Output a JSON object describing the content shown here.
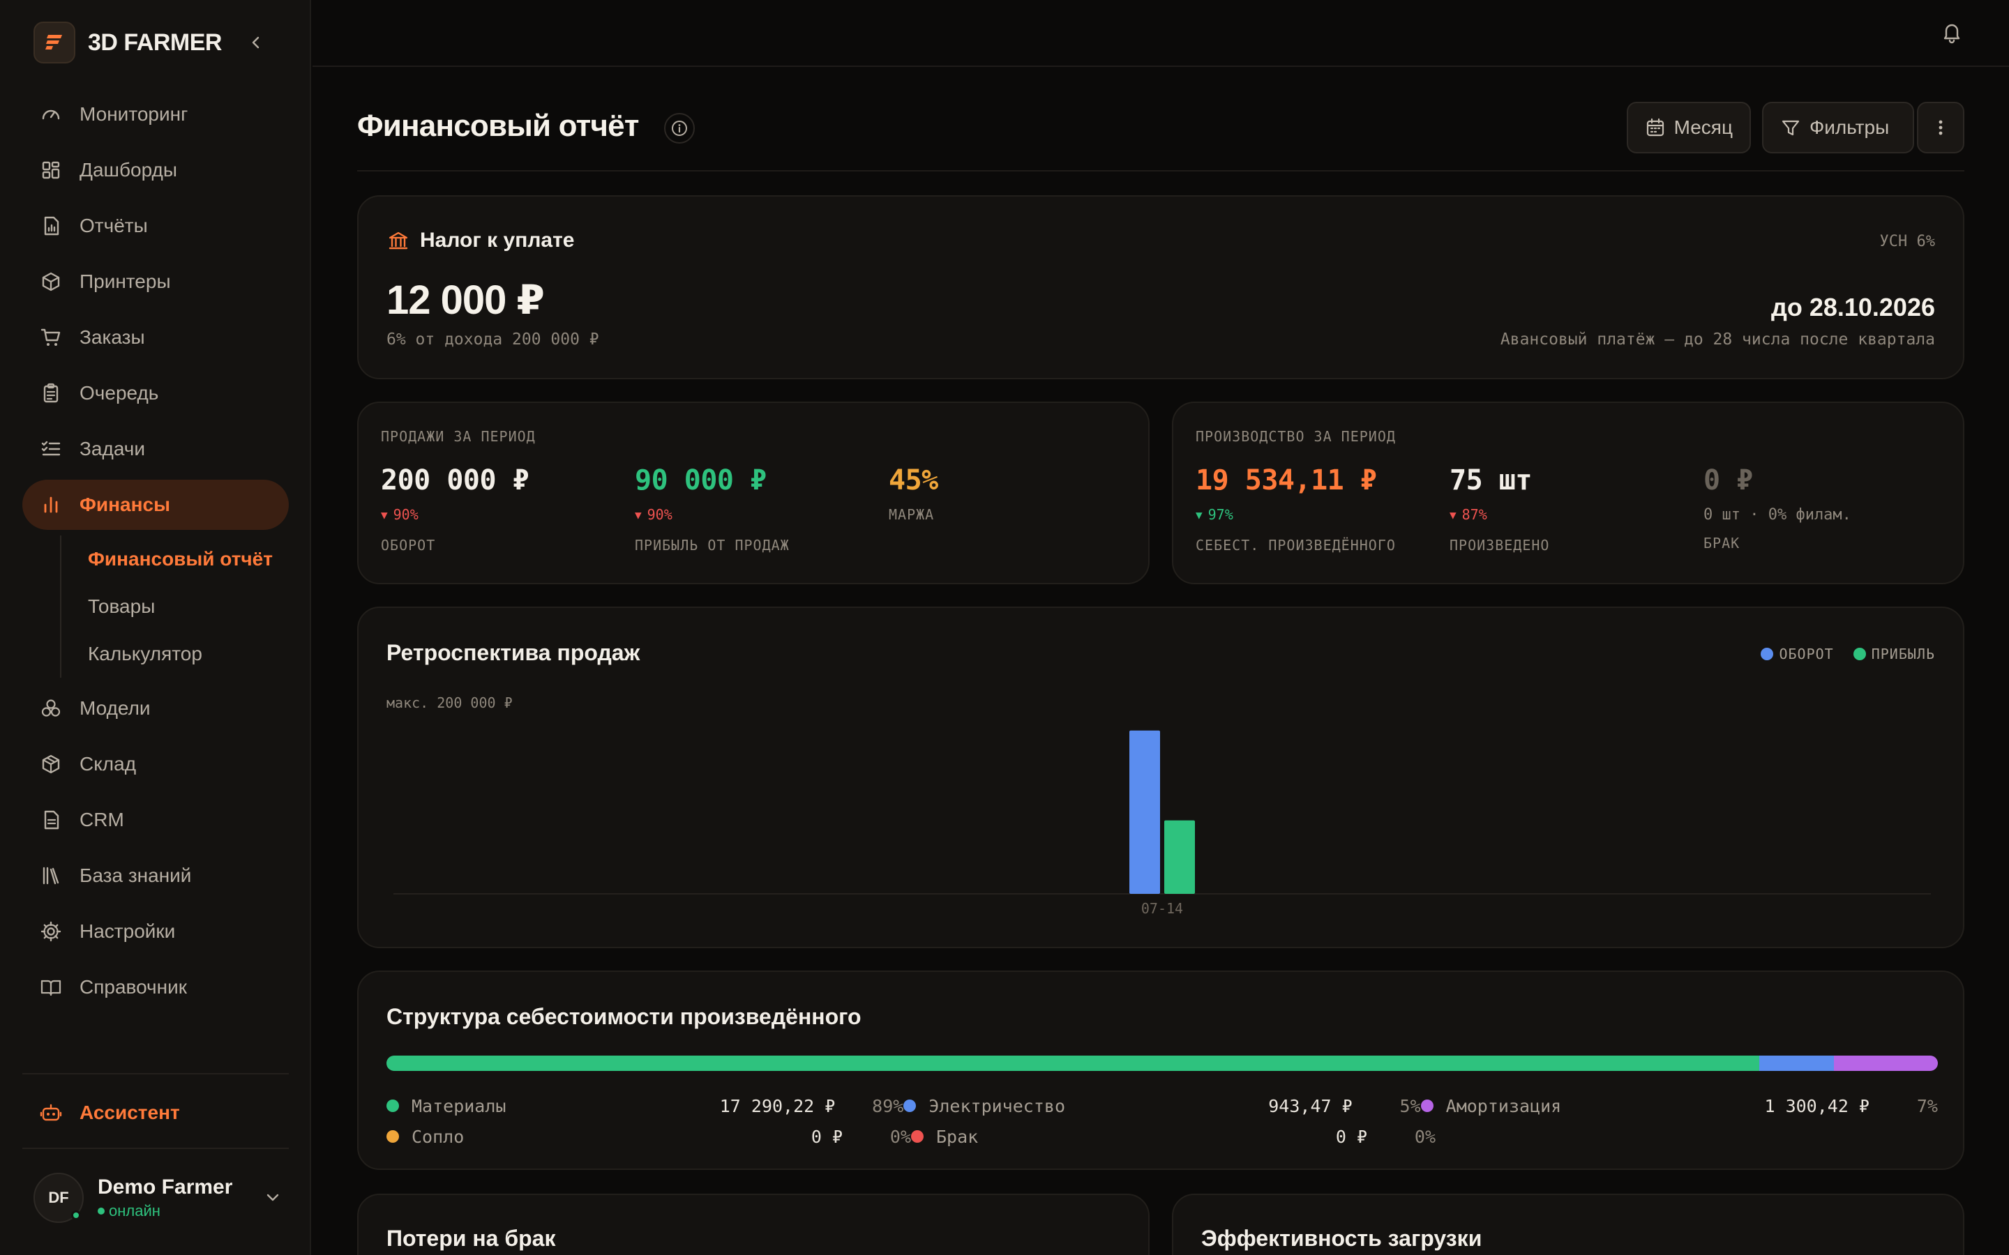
{
  "app": {
    "name": "3D FARMER"
  },
  "sidebar": {
    "items": [
      {
        "label": "Мониторинг",
        "icon": "gauge-icon"
      },
      {
        "label": "Дашборды",
        "icon": "dashboard-icon"
      },
      {
        "label": "Отчёты",
        "icon": "report-icon"
      },
      {
        "label": "Принтеры",
        "icon": "printer-box-icon"
      },
      {
        "label": "Заказы",
        "icon": "cart-icon"
      },
      {
        "label": "Очередь",
        "icon": "clipboard-icon"
      },
      {
        "label": "Задачи",
        "icon": "tasks-icon"
      },
      {
        "label": "Финансы",
        "icon": "bar-chart-icon",
        "active": true
      }
    ],
    "finance_sub": [
      {
        "label": "Финансовый отчёт",
        "active": true
      },
      {
        "label": "Товары"
      },
      {
        "label": "Калькулятор"
      }
    ],
    "items_after": [
      {
        "label": "Модели",
        "icon": "models-icon"
      },
      {
        "label": "Склад",
        "icon": "warehouse-icon"
      },
      {
        "label": "CRM",
        "icon": "document-icon"
      },
      {
        "label": "База знаний",
        "icon": "library-icon"
      },
      {
        "label": "Настройки",
        "icon": "gear-icon"
      },
      {
        "label": "Справочник",
        "icon": "book-icon"
      }
    ],
    "assistant": "Ассистент",
    "user": {
      "initials": "DF",
      "name": "Demo Farmer",
      "status": "онлайн"
    }
  },
  "header": {
    "title": "Финансовый отчёт",
    "period_button": "Месяц",
    "filters_button": "Фильтры"
  },
  "tax": {
    "title": "Налог к уплате",
    "regime": "УСН 6%",
    "amount": "12 000 ₽",
    "basis": "6% от дохода 200 000 ₽",
    "due": "до 28.10.2026",
    "due_note": "Авансовый платёж — до 28 числа после квартала"
  },
  "sales": {
    "label": "ПРОДАЖИ ЗА ПЕРИОД",
    "revenue": {
      "value": "200 000 ₽",
      "change": "90%",
      "caption": "ОБОРОТ"
    },
    "profit": {
      "value": "90 000 ₽",
      "change": "90%",
      "caption": "ПРИБЫЛЬ ОТ ПРОДАЖ"
    },
    "margin": {
      "value": "45%",
      "caption": "МАРЖА"
    }
  },
  "production": {
    "label": "ПРОИЗВОДСТВО ЗА ПЕРИОД",
    "cost": {
      "value": "19 534,11 ₽",
      "change": "97%",
      "caption": "СЕБЕСТ. ПРОИЗВЕДЁННОГО"
    },
    "produced": {
      "value": "75 шт",
      "change": "87%",
      "caption": "ПРОИЗВЕДЕНО"
    },
    "defect": {
      "value": "0 ₽",
      "note": "0 шт · 0% филам.",
      "caption": "БРАК"
    }
  },
  "colors": {
    "accent": "#ff7a3a",
    "revenue": "#5b8def",
    "profit": "#2ec27e",
    "margin": "#f0a63a",
    "down": "#ef5350",
    "amortization": "#b765e6"
  },
  "chart_data": {
    "type": "bar",
    "title": "Ретроспектива продаж",
    "max_label": "макс. 200 000 ₽",
    "categories": [
      "07-14"
    ],
    "series": [
      {
        "name": "ОБОРОТ",
        "values": [
          200000
        ]
      },
      {
        "name": "ПРИБЫЛЬ",
        "values": [
          90000
        ]
      }
    ],
    "ylim": [
      0,
      222000
    ],
    "legend": "top-right",
    "grid": false
  },
  "cost_structure": {
    "title": "Структура себестоимости произведённого",
    "items": [
      {
        "name": "Материалы",
        "value": "17 290,22 ₽",
        "pct": "89%",
        "share": 0.885,
        "color": "#2ec27e"
      },
      {
        "name": "Электричество",
        "value": "943,47 ₽",
        "pct": "5%",
        "share": 0.048,
        "color": "#5b8def"
      },
      {
        "name": "Амортизация",
        "value": "1 300,42 ₽",
        "pct": "7%",
        "share": 0.067,
        "color": "#b765e6"
      },
      {
        "name": "Сопло",
        "value": "0 ₽",
        "pct": "0%",
        "share": 0,
        "color": "#f0a63a"
      },
      {
        "name": "Брак",
        "value": "0 ₽",
        "pct": "0%",
        "share": 0,
        "color": "#ef5350"
      }
    ]
  },
  "bottom_cards": {
    "defect_losses": "Потери на брак",
    "load_efficiency": "Эффективность загрузки"
  }
}
